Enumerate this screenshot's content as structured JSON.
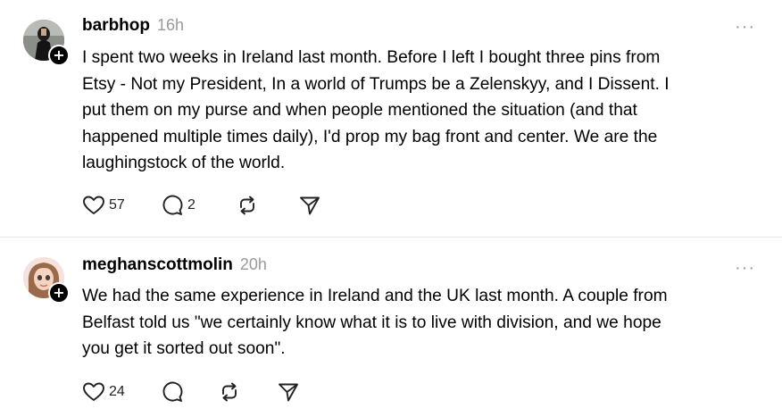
{
  "posts": [
    {
      "username": "barbhop",
      "time": "16h",
      "lines": [
        "I spent two weeks in Ireland last month. Before I left I bought three pins from",
        "Etsy - Not my President, In a world of Trumps be a Zelenskyy, and I Dissent. I",
        "put them on my purse and when people mentioned the situation (and that",
        "happened multiple times daily), I'd prop my bag front and center. We are the",
        "laughingstock of the world."
      ],
      "likes": "57",
      "replies": "2",
      "reposts": "",
      "follow_symbol": "+",
      "more_symbol": "···"
    },
    {
      "username": "meghanscottmolin",
      "time": "20h",
      "lines": [
        "We had the same experience in Ireland and the UK last month. A couple from",
        "Belfast told us \"we certainly know what it is to live with division, and we hope",
        "you get it sorted out soon\"."
      ],
      "likes": "24",
      "replies": "",
      "reposts": "",
      "follow_symbol": "+",
      "more_symbol": "···"
    }
  ],
  "icons": {
    "like": "heart-icon",
    "reply": "comment-icon",
    "repost": "repost-icon",
    "share": "send-icon"
  }
}
